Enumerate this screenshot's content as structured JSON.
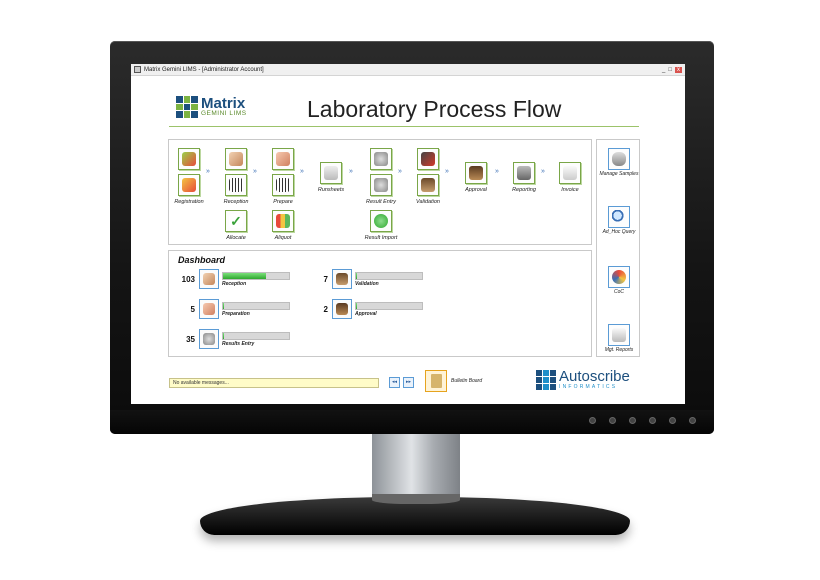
{
  "window": {
    "title": "Matrix Gemini LIMS - [Administrator Account]",
    "controls": [
      "_",
      "□",
      "x"
    ]
  },
  "brand": {
    "name": "Matrix",
    "sub": "GEMINI LIMS"
  },
  "page_title": "Laboratory Process Flow",
  "flow": {
    "steps": {
      "registration": {
        "label": "Registration",
        "icon": "registration-icon"
      },
      "reception": {
        "label": "Reception",
        "icon": "reception-icon"
      },
      "prepare": {
        "label": "Prepare",
        "icon": "prepare-icon"
      },
      "runsheets": {
        "label": "Runsheets",
        "icon": "runsheets-icon"
      },
      "result_entry": {
        "label": "Result Entry",
        "icon": "result-entry-icon"
      },
      "validation": {
        "label": "Validation",
        "icon": "validation-icon"
      },
      "approval": {
        "label": "Approval",
        "icon": "approval-icon"
      },
      "reporting": {
        "label": "Reporting",
        "icon": "reporting-icon"
      },
      "invoice": {
        "label": "Invoice",
        "icon": "invoice-icon"
      },
      "allocate": {
        "label": "Allocate",
        "icon": "checkmark-icon"
      },
      "aliquot": {
        "label": "Aliquot",
        "icon": "aliquot-icon"
      },
      "result_import": {
        "label": "Result Import",
        "icon": "result-import-icon"
      }
    },
    "arrow": "»"
  },
  "dashboard": {
    "title": "Dashboard",
    "items": [
      {
        "count": "103",
        "label": "Reception",
        "progress": 0.65,
        "icon": "reception-icon"
      },
      {
        "count": "5",
        "label": "Preparation",
        "progress": 0.02,
        "icon": "prepare-icon"
      },
      {
        "count": "35",
        "label": "Results Entry",
        "progress": 0.02,
        "icon": "result-entry-icon"
      },
      {
        "count": "7",
        "label": "Validation",
        "progress": 0.02,
        "icon": "validation-icon"
      },
      {
        "count": "2",
        "label": "Approval",
        "progress": 0.02,
        "icon": "approval-icon"
      }
    ]
  },
  "side": {
    "items": [
      {
        "label": "Manage Samples",
        "icon": "samples-icon"
      },
      {
        "label": "Ad_Hoc Query",
        "icon": "magnifier-icon"
      },
      {
        "label": "CoC",
        "icon": "coc-icon"
      },
      {
        "label": "Mgt. Reports",
        "icon": "report-icon"
      }
    ]
  },
  "footer": {
    "message": "No available messages...",
    "nav_prev": "◂◂",
    "nav_next": "▸▸",
    "bulletin_label": "Bulletin Board"
  },
  "vendor": {
    "name": "Autoscribe",
    "sub": "INFORMATICS"
  },
  "colors": {
    "brand_blue": "#1c4f7e",
    "brand_green": "#7cb342",
    "progress_green": "#2ea82e",
    "message_yellow": "#fffcc8"
  }
}
